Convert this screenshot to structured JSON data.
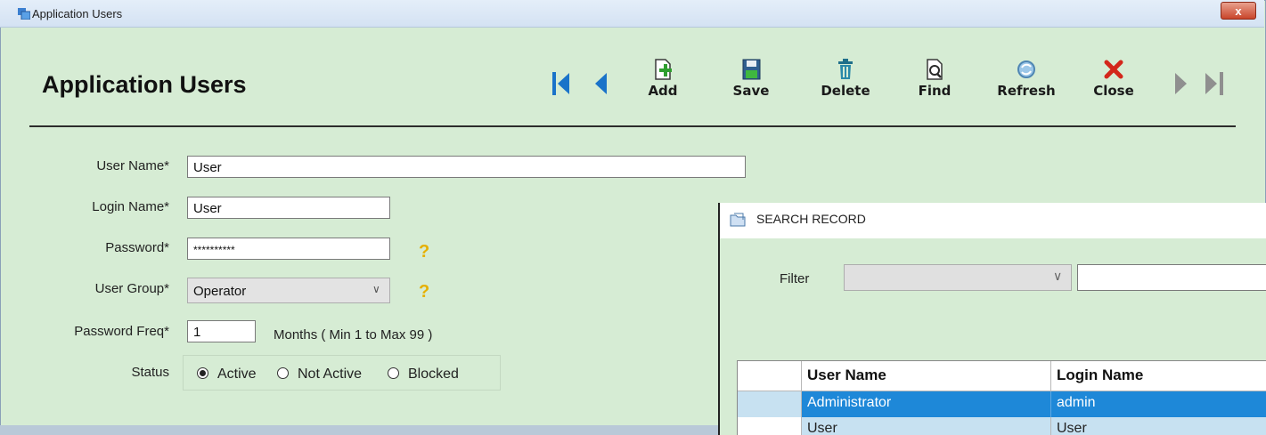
{
  "window": {
    "title": "Application Users",
    "close_glyph": "x"
  },
  "page_title": "Application Users",
  "toolbar": {
    "nav_first_icon": "first-record-icon",
    "nav_prev_icon": "prev-record-icon",
    "nav_next_icon": "next-record-icon",
    "nav_last_icon": "last-record-icon",
    "add_label": "Add",
    "save_label": "Save",
    "delete_label": "Delete",
    "find_label": "Find",
    "refresh_label": "Refresh",
    "close_label": "Close"
  },
  "form": {
    "user_name": {
      "label": "User Name*",
      "value": "User"
    },
    "login_name": {
      "label": "Login Name*",
      "value": "User"
    },
    "password": {
      "label": "Password*",
      "value": "**********"
    },
    "user_group": {
      "label": "User Group*",
      "value": "Operator"
    },
    "password_freq": {
      "label": "Password Freq*",
      "value": "1",
      "hint": "Months ( Min 1 to Max 99 )"
    },
    "status": {
      "label": "Status",
      "options": [
        "Active",
        "Not Active",
        "Blocked"
      ],
      "selected": "Active"
    },
    "help_glyph": "?"
  },
  "search_dialog": {
    "title": "SEARCH RECORD",
    "filter_label": "Filter",
    "filter_value": "",
    "filter_text": "",
    "columns": [
      "User Name",
      "Login Name"
    ],
    "rows": [
      {
        "user_name": "Administrator",
        "login_name": "admin",
        "selected": true
      },
      {
        "user_name": "User",
        "login_name": "User",
        "selected": false
      }
    ]
  },
  "colors": {
    "form_bg": "#d6ecd4",
    "nav_arrow_blue": "#1a73c9",
    "nav_arrow_grey": "#8f8f8f",
    "row_selected": "#1e88d8",
    "row_normal": "#c7e1f1",
    "close_red": "#d3271b"
  }
}
